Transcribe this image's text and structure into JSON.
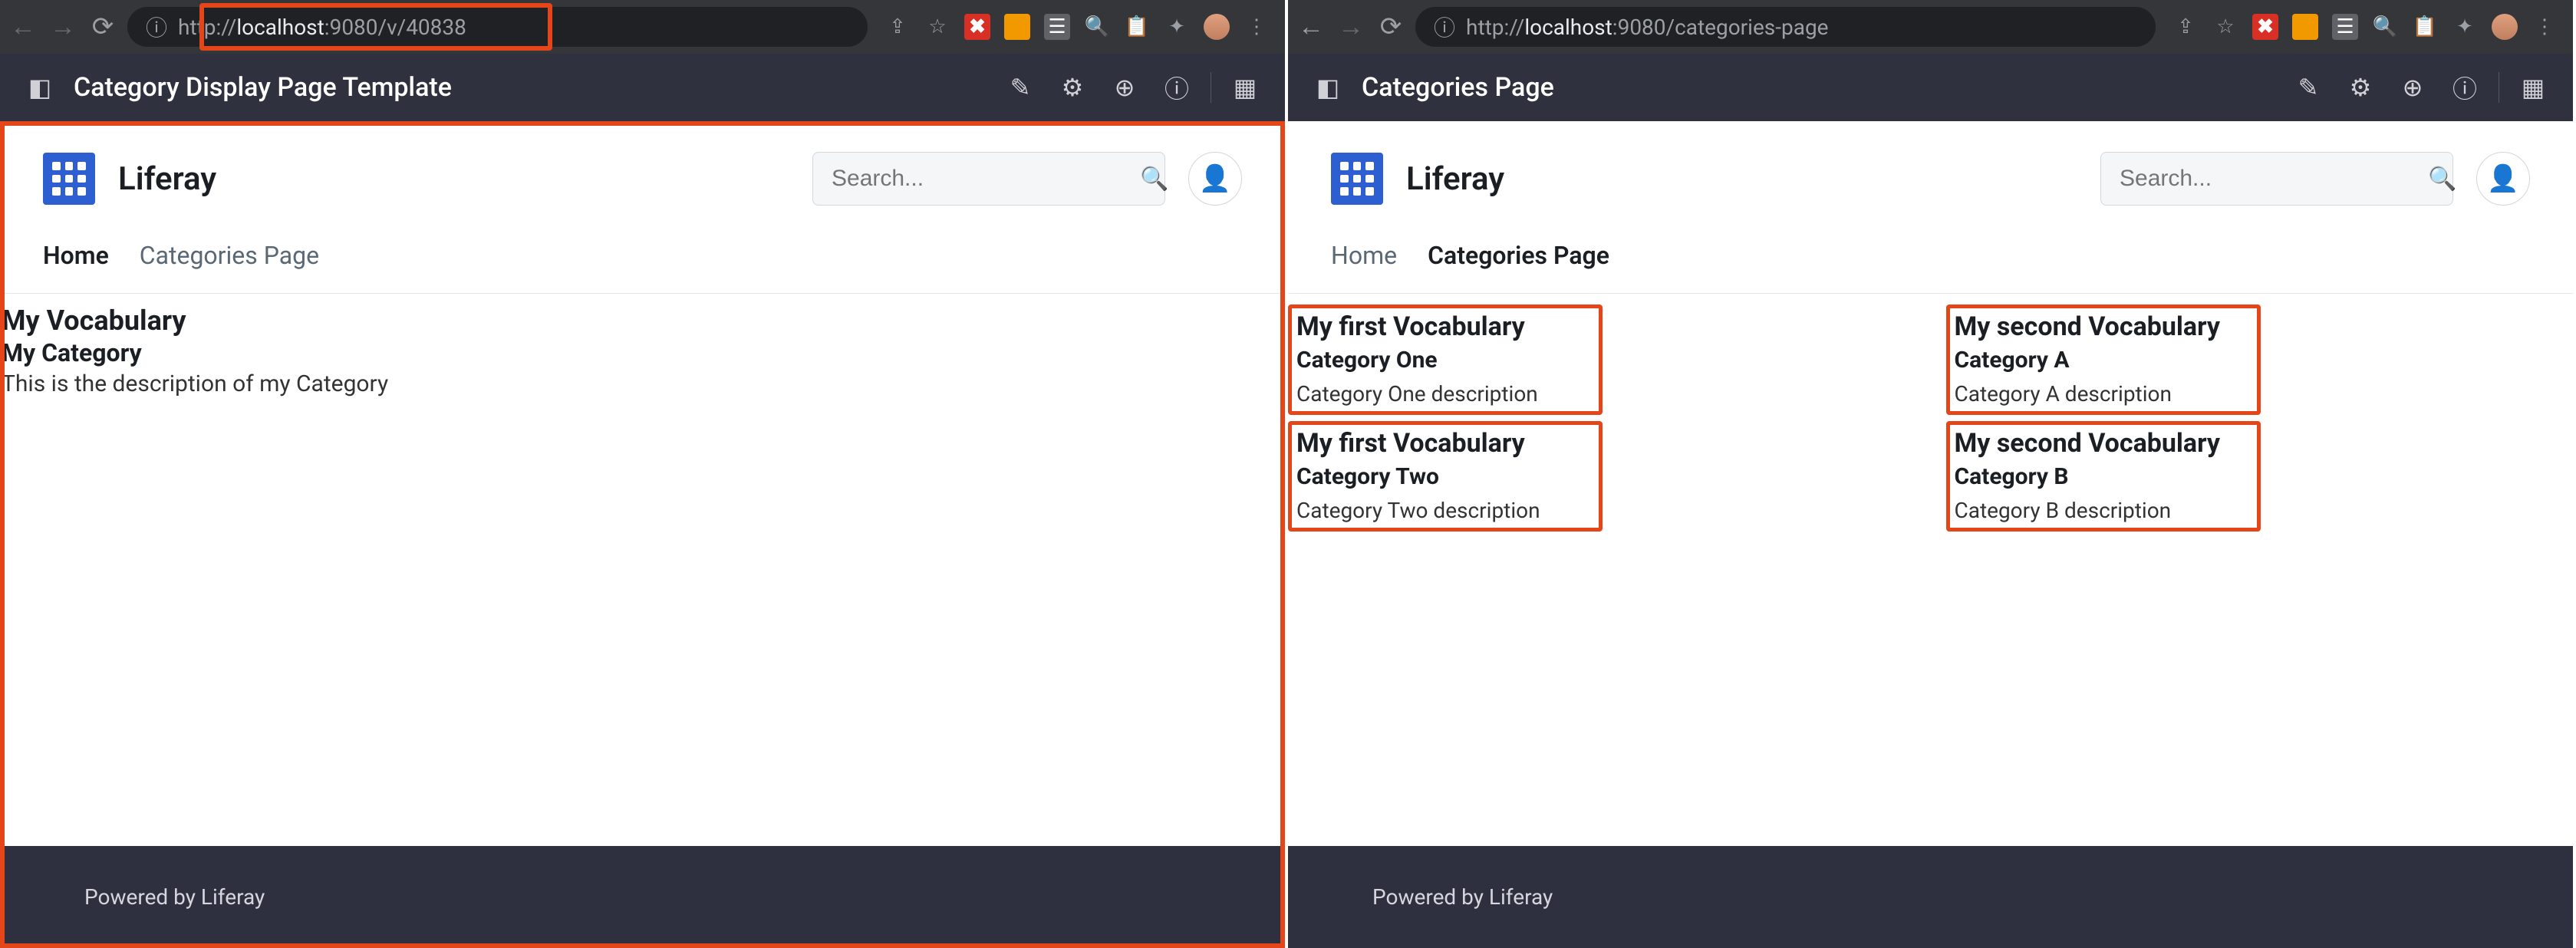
{
  "left": {
    "url_pre": "http://",
    "url_host": "localhost",
    "url_rest": ":9080/v/40838",
    "ctrl_title": "Category Display Page Template",
    "brand": "Liferay",
    "search_placeholder": "Search...",
    "nav": {
      "home": "Home",
      "categories": "Categories Page"
    },
    "content": {
      "vocab": "My Vocabulary",
      "category": "My Category",
      "desc": "This is the description of my Category"
    },
    "footer": "Powered by Liferay"
  },
  "right": {
    "url_pre": "http://",
    "url_host": "localhost",
    "url_rest": ":9080/categories-page",
    "ctrl_title": "Categories Page",
    "brand": "Liferay",
    "search_placeholder": "Search...",
    "nav": {
      "home": "Home",
      "categories": "Categories Page"
    },
    "cards": [
      {
        "vocab": "My first Vocabulary",
        "category": "Category One",
        "desc": "Category One description"
      },
      {
        "vocab": "My second Vocabulary",
        "category": "Category A",
        "desc": "Category A description"
      },
      {
        "vocab": "My first Vocabulary",
        "category": "Category Two",
        "desc": "Category Two description"
      },
      {
        "vocab": "My second Vocabulary",
        "category": "Category B",
        "desc": "Category B description"
      }
    ],
    "footer": "Powered by Liferay"
  }
}
